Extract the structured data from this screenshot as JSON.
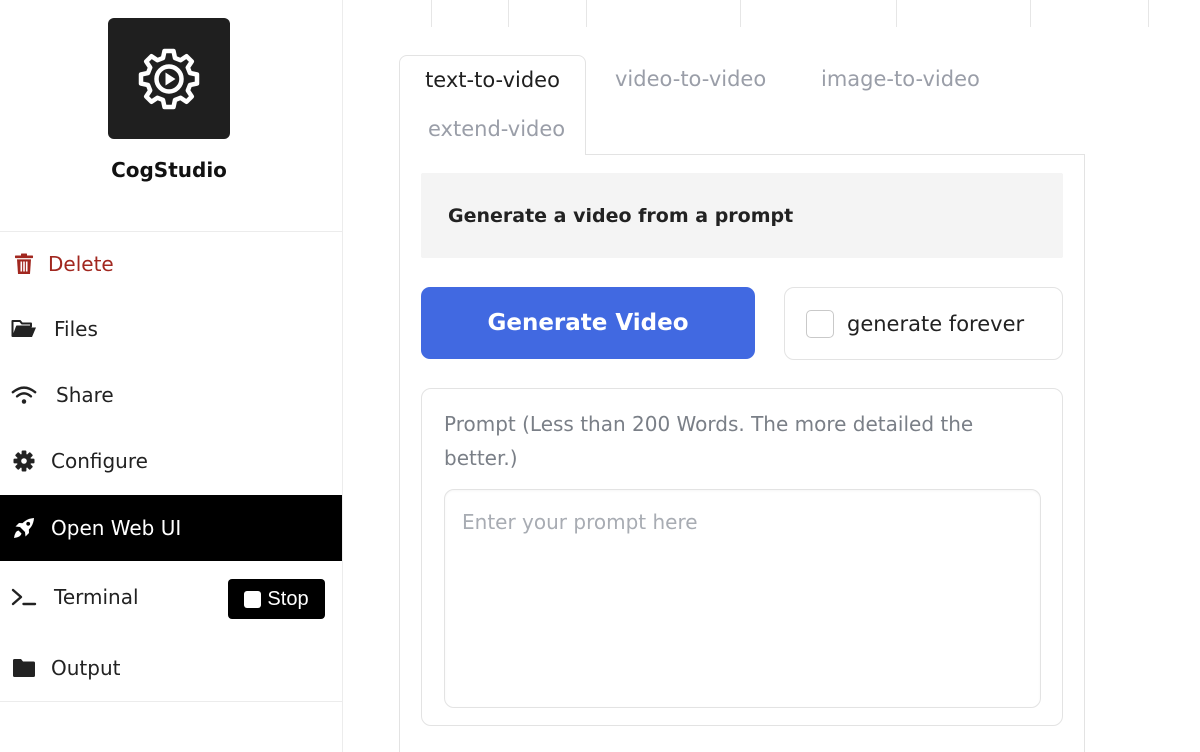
{
  "app": {
    "name": "CogStudio",
    "logo_icon": "gear-play-icon"
  },
  "sidebar": {
    "items": [
      {
        "id": "delete",
        "label": "Delete",
        "icon": "trash-icon",
        "color": "#a1271f"
      },
      {
        "id": "files",
        "label": "Files",
        "icon": "folder-open-icon"
      },
      {
        "id": "share",
        "label": "Share",
        "icon": "wifi-icon"
      },
      {
        "id": "configure",
        "label": "Configure",
        "icon": "gear-icon"
      },
      {
        "id": "open-web-ui",
        "label": "Open Web UI",
        "icon": "rocket-icon",
        "active": true
      },
      {
        "id": "terminal",
        "label": "Terminal",
        "icon": "terminal-icon"
      },
      {
        "id": "output",
        "label": "Output",
        "icon": "folder-icon"
      }
    ],
    "stop_label": "Stop"
  },
  "tabs": [
    {
      "label": "text-to-video",
      "selected": true
    },
    {
      "label": "video-to-video"
    },
    {
      "label": "image-to-video"
    },
    {
      "label": "extend-video"
    }
  ],
  "panel": {
    "description": "Generate a video from a prompt",
    "generate_label": "Generate Video",
    "generate_forever_label": "generate forever",
    "generate_forever_checked": false,
    "prompt_label": "Prompt (Less than 200 Words. The more detailed the better.)",
    "prompt_placeholder": "Enter your prompt here",
    "prompt_value": ""
  },
  "colors": {
    "accent": "#4169e1",
    "danger": "#a1271f",
    "active_bg": "#000000"
  }
}
